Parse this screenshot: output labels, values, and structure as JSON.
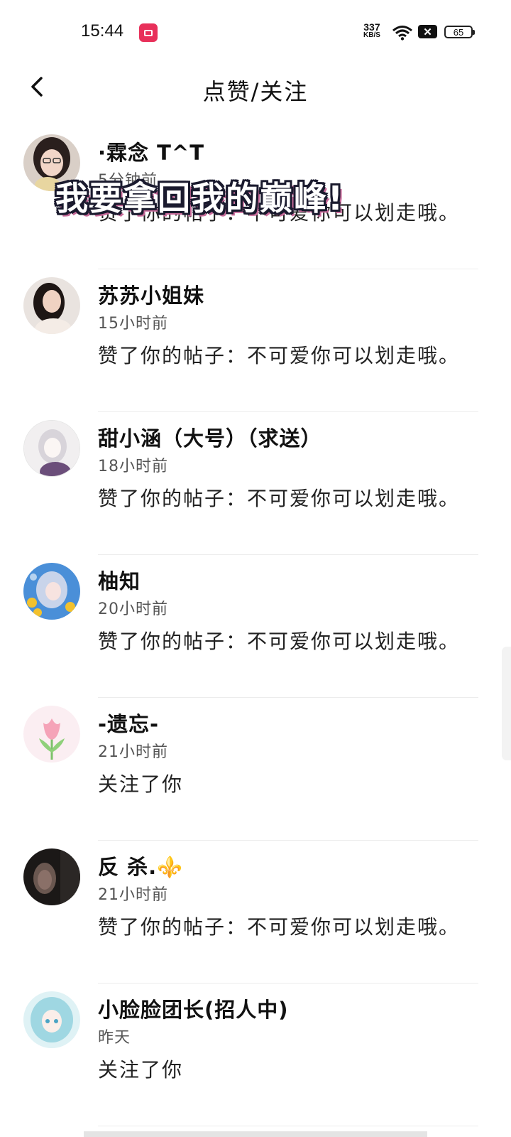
{
  "status_bar": {
    "time": "15:44",
    "net_speed_value": "337",
    "net_speed_unit": "KB/S",
    "close_badge": "✕",
    "battery": "65"
  },
  "nav": {
    "title": "点赞/关注"
  },
  "overlay_text": "我要拿回我的巅峰!",
  "notifications": [
    {
      "name": "·霖念 T^T",
      "time": "5分钟前",
      "message": "赞了你的帖子：不可爱你可以划走哦。"
    },
    {
      "name": "苏苏小姐妹",
      "time": "15小时前",
      "message": "赞了你的帖子：不可爱你可以划走哦。"
    },
    {
      "name": "甜小涵（大号）（求送）",
      "time": "18小时前",
      "message": "赞了你的帖子：不可爱你可以划走哦。"
    },
    {
      "name": "柚知",
      "time": "20小时前",
      "message": "赞了你的帖子：不可爱你可以划走哦。"
    },
    {
      "name": "-遗忘-",
      "time": "21小时前",
      "message": "关注了你"
    },
    {
      "name": "反  杀.⚜️",
      "time": "21小时前",
      "message": "赞了你的帖子：不可爱你可以划走哦。"
    },
    {
      "name": "小脸脸团长(招人中)",
      "time": "昨天",
      "message": "关注了你"
    }
  ],
  "colors": {
    "accent": "#e8305a",
    "divider": "#ececec"
  }
}
